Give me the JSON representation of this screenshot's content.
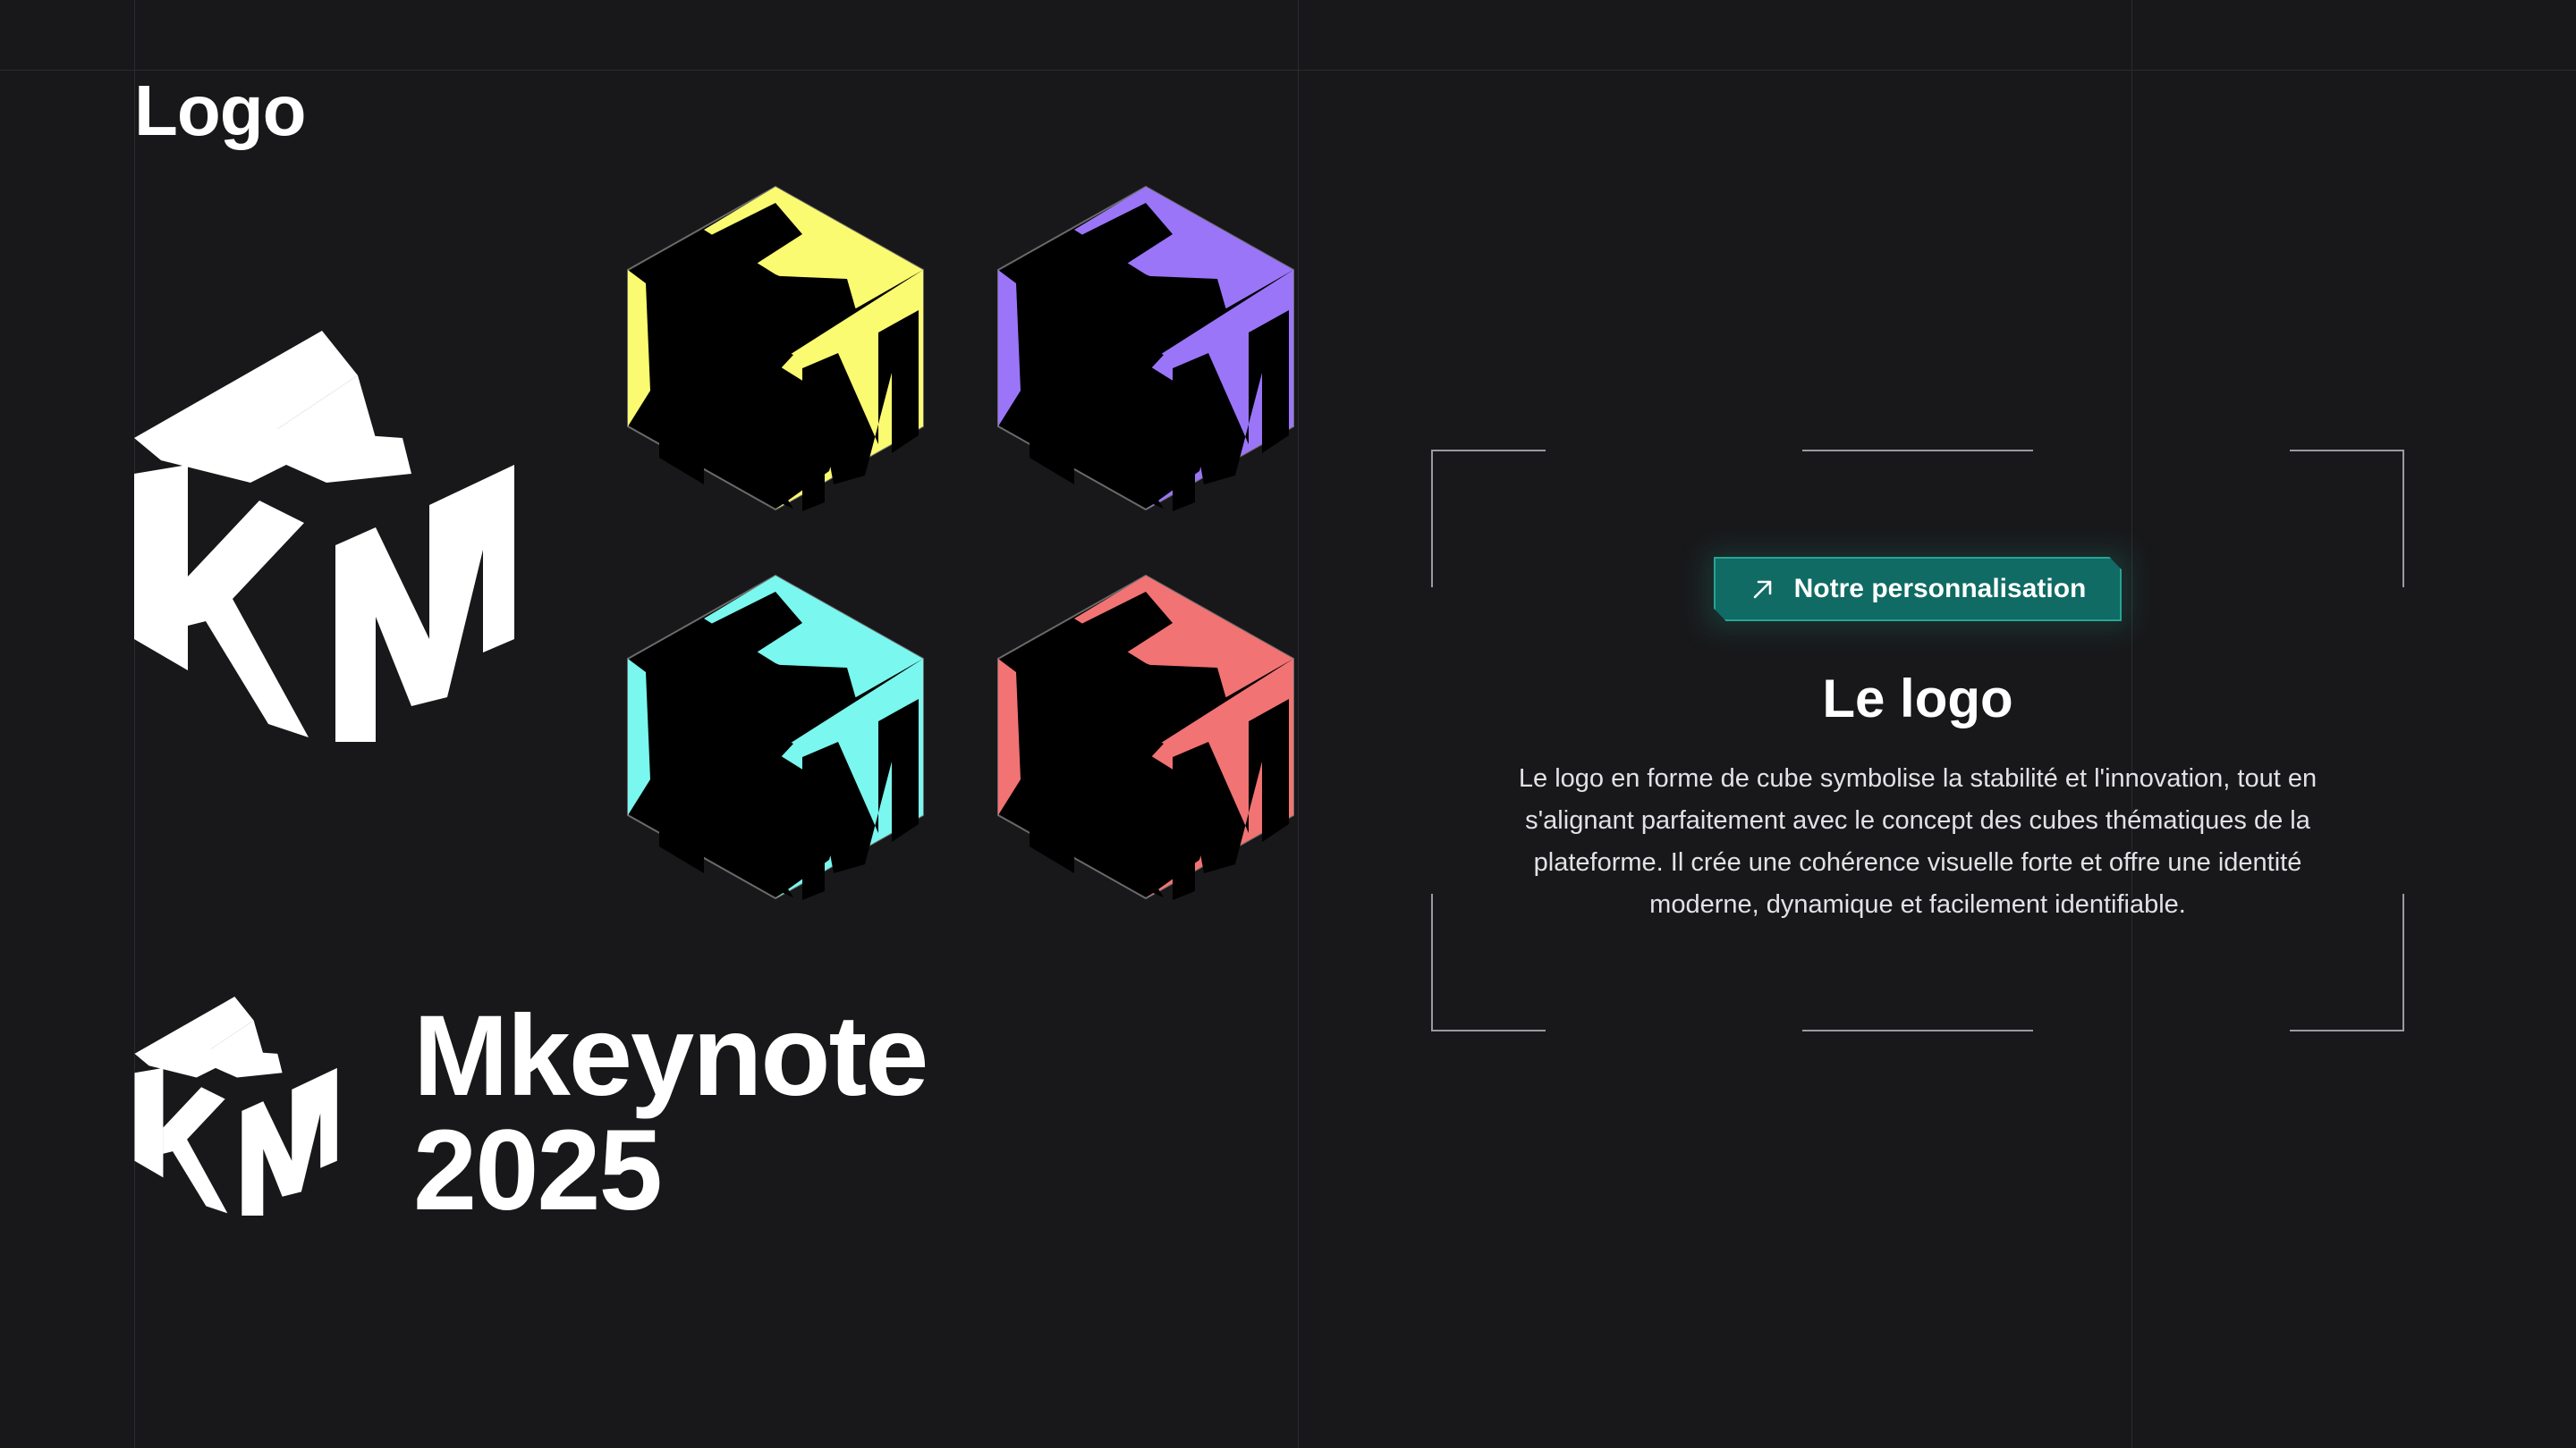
{
  "section": {
    "title": "Logo"
  },
  "colors": {
    "background": "#18181a",
    "gridline": "#2c2c30",
    "logo_primary": "#ffffff",
    "variant_yellow": "#fbfb72",
    "variant_purple": "#9b75f8",
    "variant_cyan": "#7af7ee",
    "variant_coral": "#f27373",
    "badge_fill": "#0f6b63",
    "badge_border": "#26a596"
  },
  "logo_variants": [
    {
      "name": "yellow",
      "color": "#fbfb72"
    },
    {
      "name": "purple",
      "color": "#9b75f8"
    },
    {
      "name": "cyan",
      "color": "#7af7ee"
    },
    {
      "name": "coral",
      "color": "#f27373"
    }
  ],
  "wordmark": {
    "line1": "Mkeynote",
    "line2": "2025"
  },
  "card": {
    "badge_icon": "arrow-up-right-icon",
    "badge_label": "Notre personnalisation",
    "title": "Le logo",
    "description": "Le logo en forme de cube symbolise la stabilité et l'innovation, tout en s'alignant parfaitement avec le concept des cubes thématiques de la plateforme. Il crée une cohérence visuelle forte et offre une identité moderne, dynamique et facilement identifiable."
  }
}
